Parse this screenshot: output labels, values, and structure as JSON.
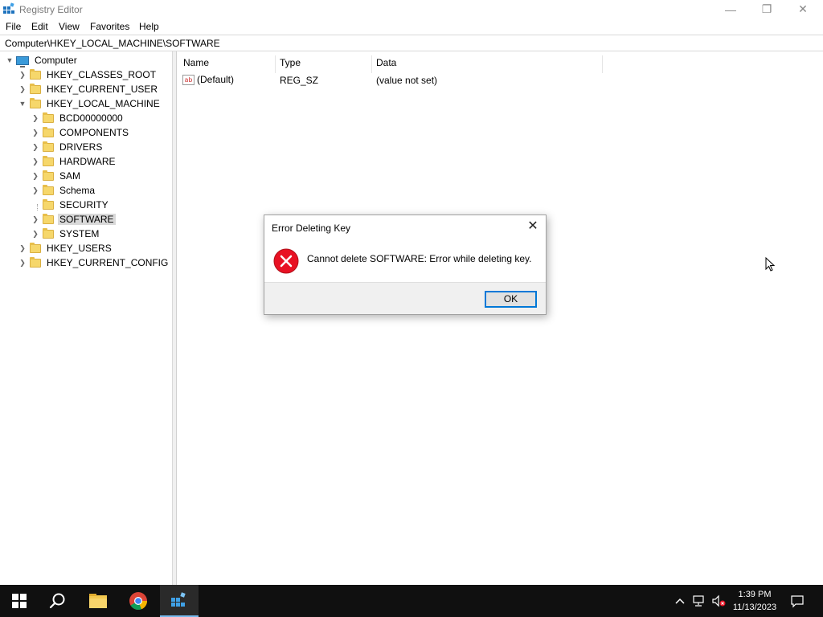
{
  "window": {
    "title": "Registry Editor",
    "min_glyph": "—",
    "restore_glyph": "❐",
    "close_glyph": "✕"
  },
  "menu": [
    "File",
    "Edit",
    "View",
    "Favorites",
    "Help"
  ],
  "address": "Computer\\HKEY_LOCAL_MACHINE\\SOFTWARE",
  "tree": {
    "root": "Computer",
    "hives": {
      "classes_root": "HKEY_CLASSES_ROOT",
      "current_user": "HKEY_CURRENT_USER",
      "local_machine": "HKEY_LOCAL_MACHINE",
      "users": "HKEY_USERS",
      "current_config": "HKEY_CURRENT_CONFIG"
    },
    "local_machine_children": [
      "BCD00000000",
      "COMPONENTS",
      "DRIVERS",
      "HARDWARE",
      "SAM",
      "Schema",
      "SECURITY",
      "SOFTWARE",
      "SYSTEM"
    ],
    "selected": "SOFTWARE"
  },
  "list": {
    "columns": [
      "Name",
      "Type",
      "Data"
    ],
    "rows": [
      {
        "icon": "ab",
        "name": "(Default)",
        "type": "REG_SZ",
        "data": "(value not set)"
      }
    ]
  },
  "dialog": {
    "title": "Error Deleting Key",
    "message": "Cannot delete SOFTWARE:  Error while deleting key.",
    "ok_label": "OK",
    "icon": "error-icon"
  },
  "taskbar": {
    "time": "1:39 PM",
    "date": "11/13/2023",
    "accent": "#76b9ed"
  },
  "colors": {
    "error_red": "#e81123",
    "selection": "#d9d9d9",
    "focus_blue": "#0078d7"
  }
}
